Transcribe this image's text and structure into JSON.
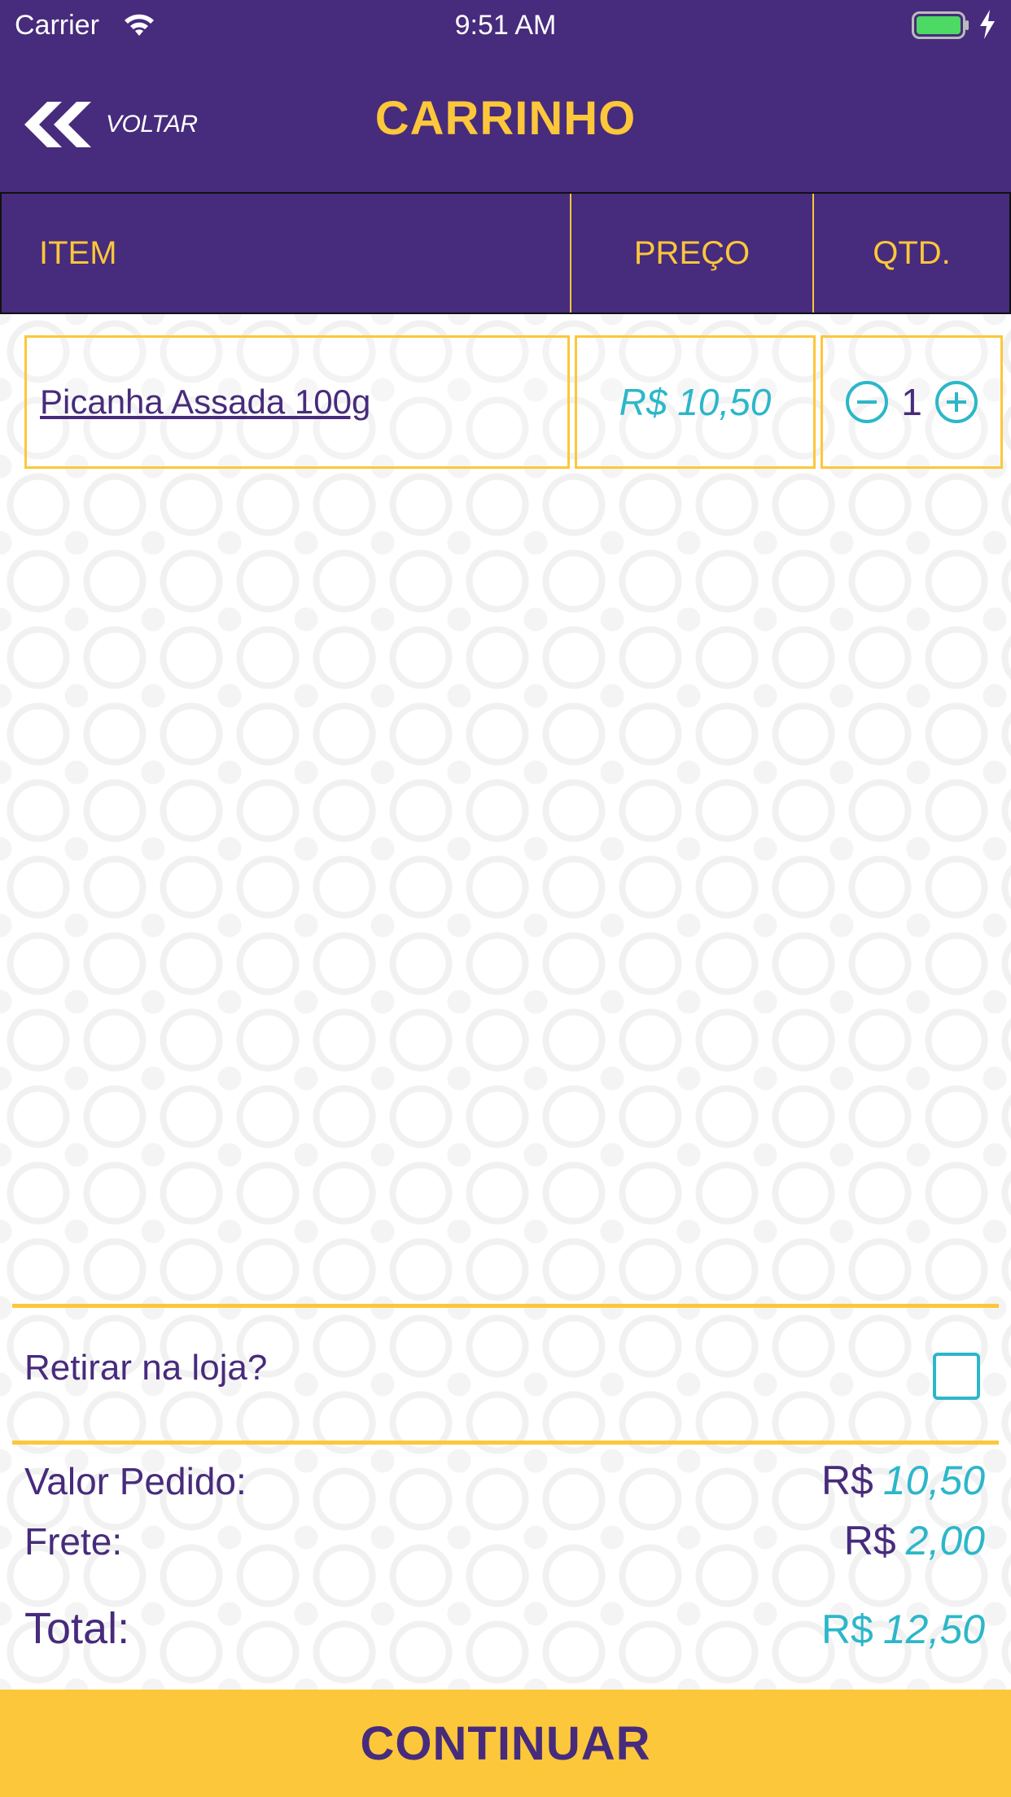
{
  "status_bar": {
    "carrier": "Carrier",
    "time": "9:51 AM"
  },
  "header": {
    "back_label": "VOLTAR",
    "title": "CARRINHO"
  },
  "table": {
    "columns": [
      "ITEM",
      "PREÇO",
      "QTD."
    ],
    "rows": [
      {
        "item": "Picanha Assada 100g",
        "price": "R$ 10,50",
        "qty": "1"
      }
    ]
  },
  "pickup": {
    "label": "Retirar na loja?",
    "checked": false
  },
  "summary": {
    "order_label": "Valor Pedido:",
    "order_currency": "R$",
    "order_amount": "10,50",
    "shipping_label": "Frete:",
    "shipping_currency": "R$",
    "shipping_amount": "2,00",
    "total_label": "Total:",
    "total_currency": "R$",
    "total_amount": "12,50"
  },
  "continue_label": "CONTINUAR",
  "colors": {
    "brand_purple": "#472b7c",
    "brand_yellow": "#fcc73a",
    "accent_teal": "#2cb7c9"
  },
  "icons": [
    "wifi-icon",
    "battery-icon",
    "charging-bolt-icon",
    "double-chevron-left-icon",
    "minus-circle-icon",
    "plus-circle-icon"
  ]
}
